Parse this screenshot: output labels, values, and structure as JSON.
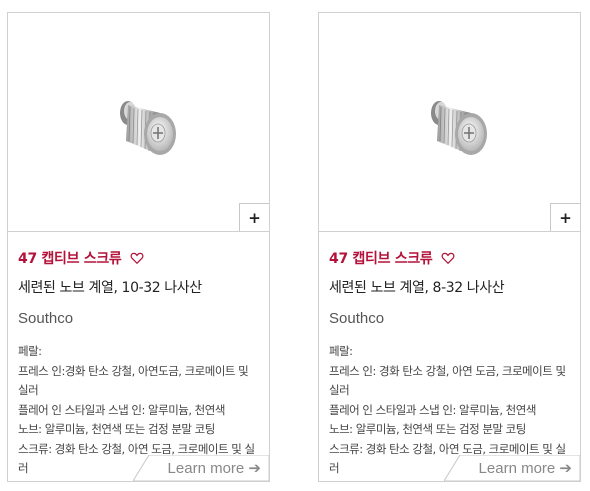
{
  "cards": [
    {
      "name": "47 캡티브 스크류",
      "subtitle": "세련된 노브 계열, 10-32 나사산",
      "brand": "Southco",
      "specs": [
        "페랄:",
        "프레스 인:경화 탄소 강철, 아연도금, 크로메이트 및 실러",
        "플레어 인 스타일과 스냅 인: 알루미늄, 천연색",
        "노브: 알루미늄, 천연색 또는 검정 분말 코팅",
        "스크류: 경화 탄소 강철, 아연 도금, 크로메이트 및 실러"
      ],
      "plus": "+",
      "learn_more": "Learn more ➔"
    },
    {
      "name": "47 캡티브 스크류",
      "subtitle": "세련된 노브 계열, 8-32 나사산",
      "brand": "Southco",
      "specs": [
        "페랄:",
        "프레스 인: 경화 탄소 강철, 아연 도금, 크로메이트 및 실러",
        "플레어 인 스타일과 스냅 인: 알루미늄, 천연색",
        "노브: 알루미늄, 천연색 또는 검정 분말 코팅",
        "스크류: 경화 탄소 강철, 아연 도금, 크로메이트 및 실러"
      ],
      "plus": "+",
      "learn_more": "Learn more ➔"
    }
  ],
  "colors": {
    "accent": "#b3123a",
    "border": "#d0d0d0",
    "muted": "#888888"
  },
  "icons": {
    "heart": "heart-outline-icon",
    "plus": "plus-icon",
    "arrow": "arrow-right-icon"
  }
}
